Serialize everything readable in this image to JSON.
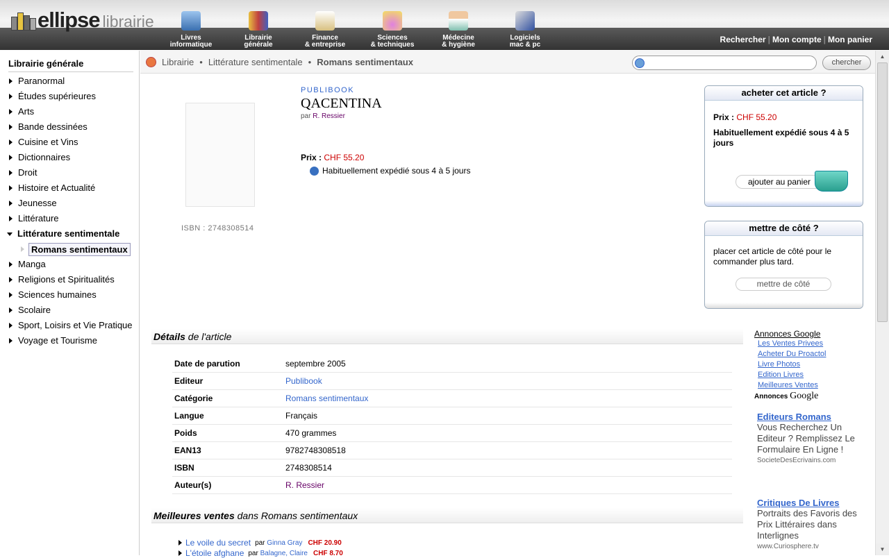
{
  "header": {
    "logo_main": "ellipse",
    "logo_sub": "librairie",
    "categories": [
      {
        "line1": "Livres",
        "line2": "informatique",
        "icon": "monitor-icon",
        "color": "#4a7fc0"
      },
      {
        "line1": "Librairie",
        "line2": "générale",
        "icon": "books-icon",
        "color": "#d8a840"
      },
      {
        "line1": "Finance",
        "line2": "& entreprise",
        "icon": "euro-cards-icon",
        "color": "#c8a860"
      },
      {
        "line1": "Sciences",
        "line2": "& techniques",
        "icon": "flask-icon",
        "color": "#c070c0"
      },
      {
        "line1": "Médecine",
        "line2": "& hygiène",
        "icon": "doctor-icon",
        "color": "#70b0a0"
      },
      {
        "line1": "Logiciels",
        "line2": "mac & pc",
        "icon": "software-box-icon",
        "color": "#4060b0"
      }
    ],
    "links": [
      "Rechercher",
      "Mon compte",
      "Mon panier"
    ]
  },
  "sidebar": {
    "title": "Librairie générale",
    "items": [
      {
        "label": "Paranormal"
      },
      {
        "label": "Études supérieures"
      },
      {
        "label": "Arts"
      },
      {
        "label": "Bande dessinées"
      },
      {
        "label": "Cuisine et Vins"
      },
      {
        "label": "Dictionnaires"
      },
      {
        "label": "Droit"
      },
      {
        "label": "Histoire et Actualité"
      },
      {
        "label": "Jeunesse"
      },
      {
        "label": "Littérature"
      },
      {
        "label": "Littérature sentimentale"
      },
      {
        "label": "Romans sentimentaux"
      },
      {
        "label": "Manga"
      },
      {
        "label": "Religions et Spiritualités"
      },
      {
        "label": "Sciences humaines"
      },
      {
        "label": "Scolaire"
      },
      {
        "label": "Sport, Loisirs et Vie Pratique"
      },
      {
        "label": "Voyage et Tourisme"
      }
    ]
  },
  "breadcrumb": [
    "Librairie",
    "Littérature sentimentale",
    "Romans sentimentaux"
  ],
  "search": {
    "placeholder": "",
    "button": "chercher"
  },
  "product": {
    "publisher": "PUBLIBOOK",
    "title": "QACENTINA",
    "by_prefix": "par",
    "author": "R. Ressier",
    "isbn_label": "ISBN : 2748308514",
    "price_label": "Prix :",
    "price": "CHF 55.20",
    "shipping": "Habituellement expédié sous 4 à 5 jours"
  },
  "buy_box": {
    "title": "acheter cet article ?",
    "price_label": "Prix :",
    "price": "CHF 55.20",
    "shipping": "Habituellement expédié sous 4 à 5 jours",
    "button": "ajouter au panier"
  },
  "save_box": {
    "title": "mettre de côté ?",
    "text": "placer cet article de côté pour le commander plus tard.",
    "button": "mettre de côté"
  },
  "details": {
    "heading_bold": "Détails",
    "heading_rest": " de l'article",
    "rows": [
      {
        "k": "Date de parution",
        "v": "septembre 2005"
      },
      {
        "k": "Editeur",
        "v": "Publibook"
      },
      {
        "k": "Catégorie",
        "v": "Romans sentimentaux"
      },
      {
        "k": "Langue",
        "v": "Français"
      },
      {
        "k": "Poids",
        "v": "470 grammes"
      },
      {
        "k": "EAN13",
        "v": "9782748308518"
      },
      {
        "k": "ISBN",
        "v": "2748308514"
      },
      {
        "k": "Auteur(s)",
        "v": "R. Ressier"
      }
    ]
  },
  "bestsellers": {
    "heading_bold": "Meilleures ventes",
    "heading_rest": " dans Romans sentimentaux",
    "items": [
      {
        "title": "Le voile du secret",
        "by": "par",
        "author": "Ginna Gray",
        "price": "CHF 20.90"
      },
      {
        "title": "L'étoile afghane",
        "by": "par",
        "author": "Balagne, Claire",
        "price": "CHF 8.70"
      }
    ]
  },
  "ads": {
    "title": "Annonces Google",
    "links": [
      "Les Ventes Privees",
      "Acheter Du Proactol",
      "Livre Photos",
      "Edition Livres",
      "Meilleures Ventes"
    ],
    "by_label": "Annonces",
    "by_brand": "Google",
    "blocks": [
      {
        "head": "Editeurs Romans",
        "desc": "Vous Recherchez Un Editeur ? Remplissez Le Formulaire En Ligne !",
        "url": "SocieteDesEcrivains.com"
      },
      {
        "head": "Critiques De Livres",
        "desc": "Portraits des Favoris des Prix Littéraires dans Interlignes",
        "url": "www.Curiosphere.tv"
      }
    ]
  }
}
